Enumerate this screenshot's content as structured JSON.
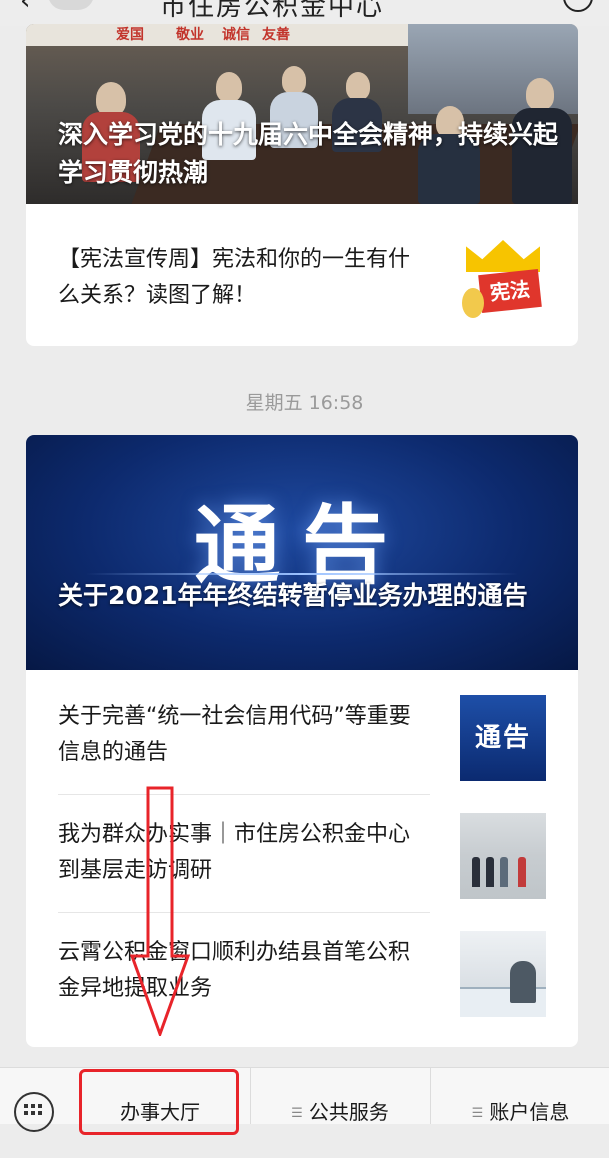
{
  "header": {
    "title": "市住房公积金中心"
  },
  "articles_group_1": {
    "hero": {
      "banner_words": [
        "爱国",
        "敬业",
        "诚信",
        "友善"
      ],
      "caption": "深入学习党的十九届六中全会精神，持续兴起学习贯彻热潮"
    },
    "items": [
      {
        "title": "【宪法宣传周】宪法和你的一生有什么关系？读图了解！",
        "thumb_text": "宪法"
      }
    ]
  },
  "timestamp": "星期五 16:58",
  "articles_group_2": {
    "hero": {
      "big_text": "通告",
      "caption": "关于2021年年终结转暂停业务办理的通告"
    },
    "items": [
      {
        "title": "关于完善“统一社会信用代码”等重要信息的通告",
        "thumb_text": "通告"
      },
      {
        "title": "我为群众办实事｜市住房公积金中心到基层走访调研"
      },
      {
        "title": "云霄公积金窗口顺利办结县首笔公积金异地提取业务"
      }
    ]
  },
  "bottom_menu": {
    "keyboard_icon": "keyboard-icon",
    "tabs": [
      {
        "label": "办事大厅"
      },
      {
        "label": "公共服务"
      },
      {
        "label": "账户信息"
      }
    ]
  },
  "annotation": {
    "arrow_color": "#e8242a",
    "box_color": "#e8242a"
  }
}
